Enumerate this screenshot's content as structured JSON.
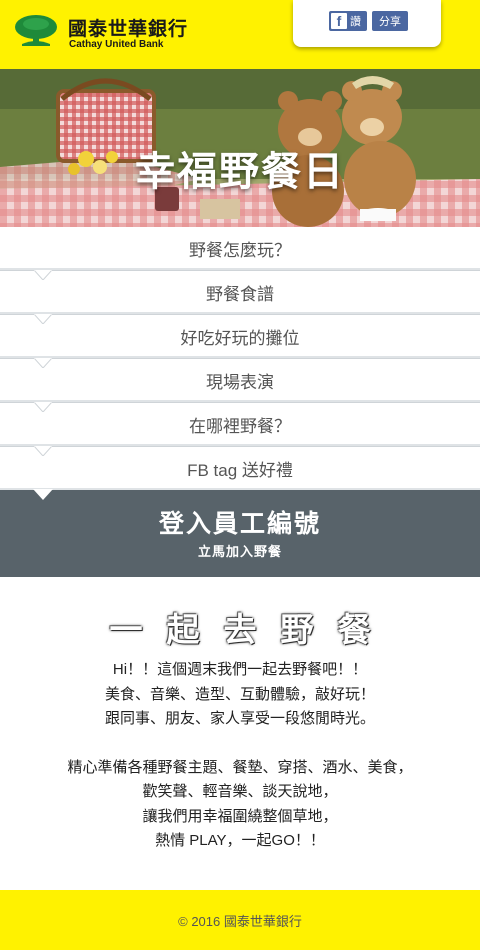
{
  "header": {
    "brand_zh": "國泰世華銀行",
    "brand_en": "Cathay United Bank",
    "fb_like_label": "讚",
    "fb_share_label": "分享"
  },
  "hero": {
    "title": "幸福野餐日"
  },
  "menu": {
    "items": [
      {
        "label": "野餐怎麼玩？"
      },
      {
        "label": "野餐食譜"
      },
      {
        "label": "好吃好玩的攤位"
      },
      {
        "label": "現場表演"
      },
      {
        "label": "在哪裡野餐？"
      },
      {
        "label": "FB tag 送好禮"
      }
    ]
  },
  "login": {
    "title": "登入員工編號",
    "subtitle": "立馬加入野餐"
  },
  "intro": {
    "title": "一起去野餐",
    "paragraph1": [
      "Hi！！這個週末我們一起去野餐吧！！",
      "美食、音樂、造型、互動體驗，敲好玩！",
      "跟同事、朋友、家人享受一段悠閒時光。"
    ],
    "paragraph2": [
      "精心準備各種野餐主題、餐墊、穿搭、酒水、美食，",
      "歡笑聲、輕音樂、談天說地，",
      "讓我們用幸福圍繞整個草地，",
      "熱情 PLAY，一起GO！！"
    ]
  },
  "footer": {
    "copyright": "© 2016 國泰世華銀行"
  },
  "colors": {
    "brand_yellow": "#fff200",
    "login_band": "#58636a",
    "fb_blue": "#4b67a1",
    "logo_green": "#1e8a3a"
  }
}
